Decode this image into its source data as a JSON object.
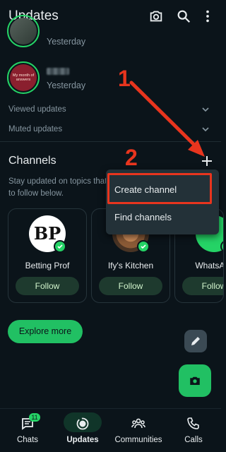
{
  "header": {
    "title": "Updates"
  },
  "status": {
    "items": [
      {
        "time": "Yesterday"
      },
      {
        "avatar_text": "My month of answers",
        "time": "Yesterday"
      }
    ]
  },
  "sections": {
    "viewed": "Viewed updates",
    "muted": "Muted updates"
  },
  "channels": {
    "title": "Channels",
    "description": "Stay updated on topics that matter to you. Find channels to follow below.",
    "cards": [
      {
        "name": "Betting Prof",
        "follow_label": "Follow",
        "avatar_text": "BP"
      },
      {
        "name": "Ify's Kitchen",
        "follow_label": "Follow"
      },
      {
        "name": "WhatsApp",
        "follow_label": "Follow"
      }
    ],
    "explore_label": "Explore more"
  },
  "menu": {
    "items": [
      "Create channel",
      "Find channels"
    ]
  },
  "annotations": {
    "one": "1",
    "two": "2"
  },
  "nav": {
    "items": [
      {
        "label": "Chats",
        "badge": "11",
        "icon": "chat-icon"
      },
      {
        "label": "Updates",
        "icon": "updates-icon",
        "active": true
      },
      {
        "label": "Communities",
        "icon": "communities-icon"
      },
      {
        "label": "Calls",
        "icon": "phone-icon"
      }
    ]
  },
  "colors": {
    "accent": "#25d366",
    "background": "#0b141a",
    "annotation": "#e8351e"
  }
}
